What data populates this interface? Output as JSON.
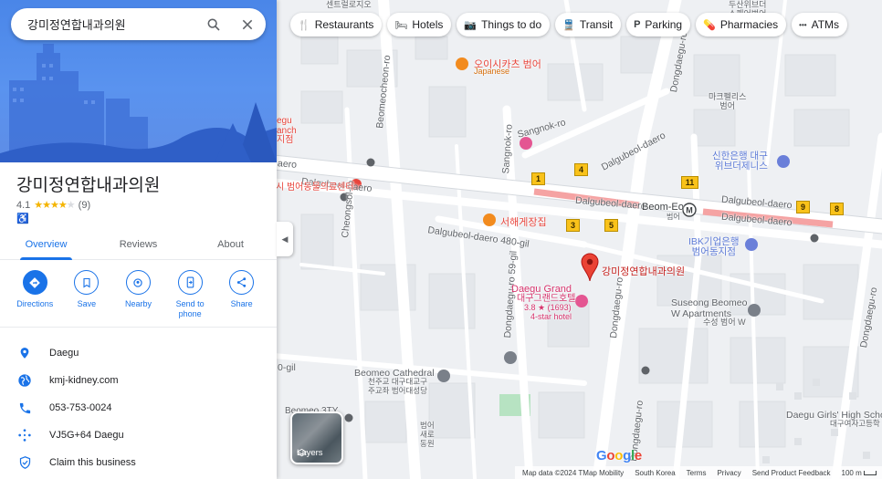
{
  "search": {
    "value": "강미정연합내과의원"
  },
  "place": {
    "name": "강미정연합내과의원",
    "rating": "4.1",
    "review_count": "(9)",
    "stars_filled": 4,
    "wheelchair_symbol": "♿"
  },
  "tabs": [
    {
      "label": "Overview"
    },
    {
      "label": "Reviews"
    },
    {
      "label": "About"
    }
  ],
  "actions": [
    {
      "label": "Directions",
      "icon": "directions-icon"
    },
    {
      "label": "Save",
      "icon": "bookmark-icon"
    },
    {
      "label": "Nearby",
      "icon": "nearby-icon"
    },
    {
      "label": "Send to\nphone",
      "icon": "send-to-phone-icon"
    },
    {
      "label": "Share",
      "icon": "share-icon"
    }
  ],
  "info": [
    {
      "text": "Daegu",
      "icon": "location-pin-icon"
    },
    {
      "text": "kmj-kidney.com",
      "icon": "globe-icon"
    },
    {
      "text": "053-753-0024",
      "icon": "phone-icon"
    },
    {
      "text": "VJ5G+64 Daegu",
      "icon": "plus-code-icon"
    },
    {
      "text": "Claim this business",
      "icon": "shield-check-icon"
    }
  ],
  "chips": [
    {
      "label": "Restaurants",
      "icon": "🍴"
    },
    {
      "label": "Hotels",
      "icon": "🛏"
    },
    {
      "label": "Things to do",
      "icon": "📷"
    },
    {
      "label": "Transit",
      "icon": "🚆"
    },
    {
      "label": "Parking",
      "icon": "P"
    },
    {
      "label": "Pharmacies",
      "icon": "💊"
    },
    {
      "label": "ATMs",
      "icon": "•••"
    }
  ],
  "map_labels": {
    "road_dalgubeol_1": "Dalgubeol-daero",
    "road_dalgubeol_2": "Dalgubeol-daero",
    "road_dalgubeol_3": "Dalgubeol-daero",
    "road_dalgubeol_4": "Dalgubeol-daero",
    "road_dalgubeol_5": "Dalgubeol-daero",
    "road_dalgubeol_left": "aero",
    "road_480gil": "Dalgubeol-daero 480-gil",
    "road_beomeocheon": "Beomeocheon-ro",
    "road_cheongsol": "Cheongsol-ro",
    "road_sangnok": "Sangnok-ro",
    "road_sangnok2": "Sangnok-ro",
    "road_59gil": "Dongdaegu-ro 59-gil",
    "road_dongdaegu_1": "Dongdaegu-ro",
    "road_dongdaegu_2": "Dongdaegu-ro",
    "road_dongdaegu_top": "Dongdaegu-ro",
    "road_dongdaegu_right": "Dongdaegu-ro",
    "road_0gil": "0-gil",
    "poi_oishi": "오이시카츠 범어",
    "poi_oishi_sub": "Japanese",
    "poi_seohae": "서해게장집",
    "poi_hospital": "시 범어동물의료센터",
    "poi_daegu_branch": "egu\nanch\n지점",
    "poi_marker_name": "강미정연합내과의원",
    "poi_grand_name": "Daegu Grand",
    "poi_grand_kr": "대구그랜드호텔",
    "poi_grand_rating": "3.8 ★ (1693)",
    "poi_grand_type": "4-star hotel",
    "poi_shinhan": "신한은행 대구\n위브더제니스",
    "poi_ibk": "IBK기업은행\n범어동지점",
    "poi_susong": "Suseong Beomeo\nW Apartments",
    "poi_susong_kr": "수성 범어 W",
    "poi_cathedral": "Beomeo Cathedral",
    "poi_cathedral_kr": "천주교 대구대교구\n주교좌 범어대성당",
    "poi_girls_high": "Daegu Girls' High Scho",
    "poi_girls_high_kr": "대구여자고등학",
    "poi_makeuri": "마크펠리스\n범어",
    "poi_beomeo_station": "Beom-Eo",
    "poi_beomeo_station_kr": "범어",
    "poi_top_center": "센트럴로지오",
    "poi_top_right": "두산위브더\n스퀘어범어",
    "poi_bottom_left": "Beomeo 3TY",
    "poi_bottom_kr": "범어\n새로\n동원",
    "route_1": "1",
    "route_4": "4",
    "route_3": "3",
    "route_5": "5",
    "route_11": "11",
    "route_9": "9",
    "route_8": "8"
  },
  "layers": {
    "label": "Layers"
  },
  "logo": "Google",
  "footer": {
    "map_data": "Map data ©2024 TMap Mobility",
    "region": "South Korea",
    "terms": "Terms",
    "privacy": "Privacy",
    "feedback": "Send Product Feedback",
    "scale": "100 m"
  },
  "colors": {
    "accent": "#1a73e8",
    "marker": "#ea4335",
    "star": "#f4b400"
  }
}
